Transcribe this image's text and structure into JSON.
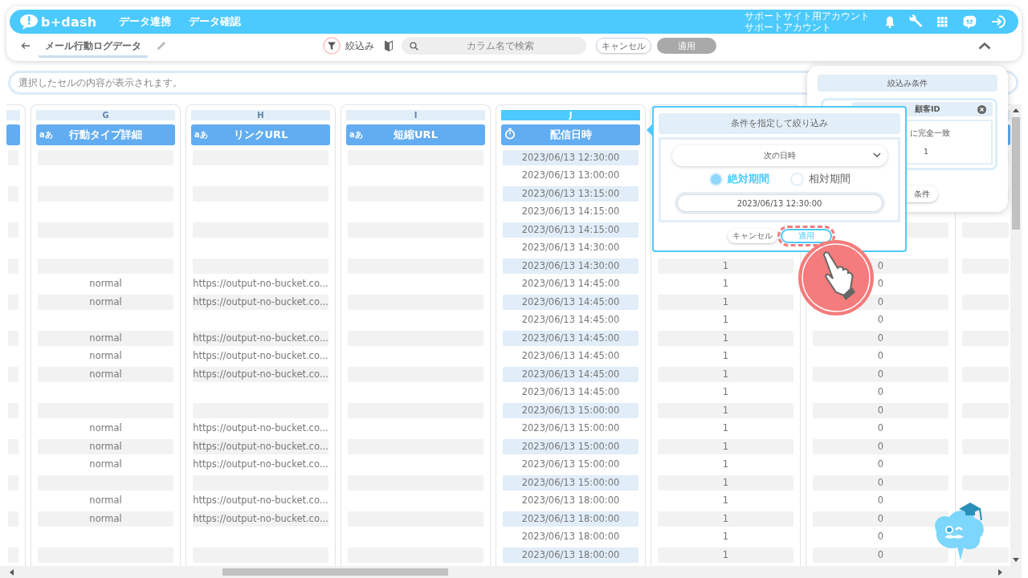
{
  "header": {
    "logo": "b+dash",
    "nav": [
      {
        "label": "データ連携"
      },
      {
        "label": "データ確認"
      }
    ],
    "account": {
      "line_1": "サポートサイト用アカウント",
      "line_2": "サポートアカウント"
    }
  },
  "toolbar": {
    "title": "メール行動ログデータ",
    "filter_label": "絞込み",
    "search": {
      "placeholder": "カラム名で検索"
    },
    "buttons": [
      {
        "label": "キャンセル",
        "kind": "outline",
        "disabled": false
      },
      {
        "label": "適用",
        "kind": "fill",
        "disabled": true
      }
    ]
  },
  "cell_viewer": {
    "placeholder": "選択したセルの内容が表示されます。"
  },
  "table": {
    "columns": [
      {
        "kind": "stub"
      },
      {
        "kind": "text",
        "letter": "G",
        "selected": false,
        "type_mark": "aあ",
        "name": "行動タイプ詳細"
      },
      {
        "kind": "text",
        "letter": "H",
        "selected": false,
        "type_mark": "aあ",
        "name": "リンクURL"
      },
      {
        "kind": "text",
        "letter": "I",
        "selected": false,
        "type_mark": "aあ",
        "name": "短縮URL"
      },
      {
        "kind": "datetime",
        "letter": "J",
        "selected": true,
        "name": "配信日時"
      },
      {
        "kind": "text"
      },
      {
        "kind": "text"
      },
      {
        "kind": "stub"
      }
    ],
    "rows": [
      {
        "delivery_datetime": "2023/06/13 12:30:00"
      },
      {
        "delivery_datetime": "2023/06/13 13:00:00"
      },
      {
        "delivery_datetime": "2023/06/13 13:15:00"
      },
      {
        "delivery_datetime": "2023/06/13 14:15:00"
      },
      {
        "delivery_datetime": "2023/06/13 14:15:00"
      },
      {
        "delivery_datetime": "2023/06/13 14:30:00"
      },
      {
        "delivery_datetime": "2023/06/13 14:30:00",
        "column_k": "1",
        "column_l": "0"
      },
      {
        "action_type_detail": "normal",
        "link_url": "https://output-no-bucket.co...",
        "delivery_datetime": "2023/06/13 14:45:00",
        "column_k": "1",
        "column_l": "0"
      },
      {
        "action_type_detail": "normal",
        "link_url": "https://output-no-bucket.co...",
        "delivery_datetime": "2023/06/13 14:45:00",
        "column_k": "1",
        "column_l": "0"
      },
      {
        "delivery_datetime": "2023/06/13 14:45:00",
        "column_k": "1",
        "column_l": "0"
      },
      {
        "action_type_detail": "normal",
        "link_url": "https://output-no-bucket.co...",
        "delivery_datetime": "2023/06/13 14:45:00",
        "column_k": "1",
        "column_l": "0"
      },
      {
        "action_type_detail": "normal",
        "link_url": "https://output-no-bucket.co...",
        "delivery_datetime": "2023/06/13 14:45:00",
        "column_k": "1",
        "column_l": "0"
      },
      {
        "action_type_detail": "normal",
        "link_url": "https://output-no-bucket.co...",
        "delivery_datetime": "2023/06/13 14:45:00",
        "column_k": "1",
        "column_l": "0"
      },
      {
        "delivery_datetime": "2023/06/13 14:45:00",
        "column_k": "1",
        "column_l": "0"
      },
      {
        "delivery_datetime": "2023/06/13 15:00:00",
        "column_k": "1",
        "column_l": "0"
      },
      {
        "action_type_detail": "normal",
        "link_url": "https://output-no-bucket.co...",
        "delivery_datetime": "2023/06/13 15:00:00",
        "column_k": "1",
        "column_l": "0"
      },
      {
        "action_type_detail": "normal",
        "link_url": "https://output-no-bucket.co...",
        "delivery_datetime": "2023/06/13 15:00:00",
        "column_k": "1",
        "column_l": "0"
      },
      {
        "action_type_detail": "normal",
        "link_url": "https://output-no-bucket.co...",
        "delivery_datetime": "2023/06/13 15:00:00",
        "column_k": "1",
        "column_l": "0"
      },
      {
        "delivery_datetime": "2023/06/13 15:00:00",
        "column_k": "1",
        "column_l": "0"
      },
      {
        "action_type_detail": "normal",
        "link_url": "https://output-no-bucket.co...",
        "delivery_datetime": "2023/06/13 18:00:00",
        "column_k": "1",
        "column_l": "0"
      },
      {
        "action_type_detail": "normal",
        "link_url": "https://output-no-bucket.co...",
        "delivery_datetime": "2023/06/13 18:00:00",
        "column_k": "1",
        "column_l": "0"
      },
      {
        "delivery_datetime": "2023/06/13 18:00:00",
        "column_k": "1",
        "column_l": "0"
      },
      {
        "delivery_datetime": "2023/06/13 18:00:00",
        "column_k": "1",
        "column_l": "0"
      }
    ]
  },
  "filter_panel": {
    "title": "絞込み条件",
    "conditions": [
      {
        "column": "顧客ID",
        "match": "に完全一致",
        "value": "1"
      }
    ],
    "button": {
      "label": "条件"
    }
  },
  "filter_popover": {
    "title": "条件を指定して絞り込み",
    "operator": {
      "value": "次の日時"
    },
    "period_options": [
      {
        "label": "絶対期間",
        "selected": true
      },
      {
        "label": "相対期間",
        "selected": false
      }
    ],
    "date": {
      "value": "2023/06/13 12:30:00"
    },
    "buttons": [
      {
        "label": "キャンセル",
        "kind": "cancel",
        "highlighted": false
      },
      {
        "label": "適用",
        "kind": "apply",
        "highlighted": true
      }
    ]
  }
}
